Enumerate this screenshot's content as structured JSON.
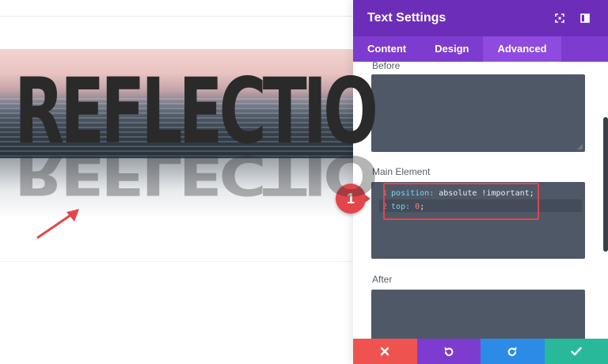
{
  "canvas": {
    "title": "REFLECTIO"
  },
  "panel": {
    "title": "Text Settings",
    "icons": {
      "expand": "expand-icon",
      "sidebar": "sidebar-toggle-icon"
    },
    "tabs": [
      {
        "label": "Content",
        "active": false
      },
      {
        "label": "Design",
        "active": false
      },
      {
        "label": "Advanced",
        "active": true
      }
    ],
    "fields": {
      "before_label": "Before",
      "main_label": "Main Element",
      "after_label": "After",
      "code": {
        "line1_no": "1",
        "line1_prop": "position:",
        "line1_val": "absolute !important;",
        "line2_no": "2",
        "line2_prop": "top:",
        "line2_val": "0",
        "line2_end": ";"
      }
    },
    "callout": "1",
    "footer": {
      "cancel": "close-icon",
      "undo": "undo-icon",
      "redo": "redo-icon",
      "save": "check-icon"
    }
  },
  "colors": {
    "header": "#6c2eb9",
    "tabs": "#7d3bcf",
    "active_tab": "#8f4be0",
    "textarea": "#4e5866",
    "cancel": "#ef5350",
    "undo": "#7e3bd0",
    "redo": "#2d8be8",
    "save": "#28b89a",
    "callout": "#e3464a"
  }
}
